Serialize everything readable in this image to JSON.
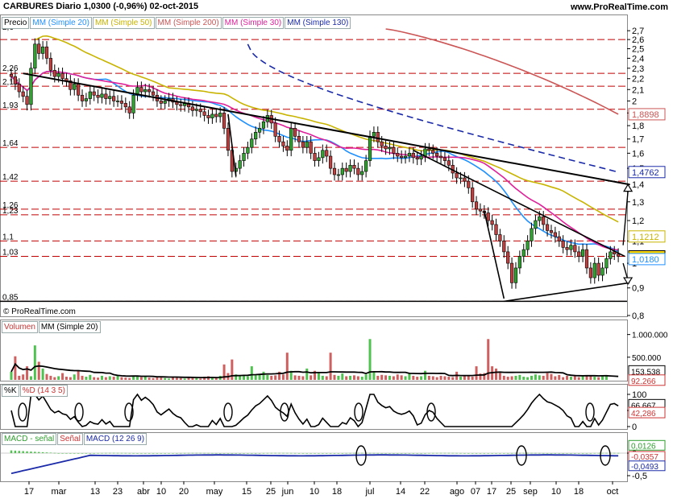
{
  "header": {
    "title": "CARBURES   Diario   1,0300 (-0,96%)   02-oct-2015",
    "site": "www.ProRealTime.com"
  },
  "price_panel": {
    "legend": [
      {
        "label": "Precio",
        "color": "#000000"
      },
      {
        "label": "MM (Simple 20)",
        "color": "#1e90ff"
      },
      {
        "label": "MM (Simple 50)",
        "color": "#c8b400"
      },
      {
        "label": "MM (Simple 200)",
        "color": "#cc5555"
      },
      {
        "label": "MM (Simple 30)",
        "color": "#e0209a"
      },
      {
        "label": "MM (Simple 130)",
        "color": "#1a2aa8"
      }
    ],
    "left_labels": [
      "2,26",
      "2,13",
      "1,93",
      "1,64",
      "1,42",
      "1,26",
      "1,23",
      "1,1",
      "1,03",
      "0,85"
    ],
    "top_left_label": "2,6",
    "watermark": "© ProRealTime.com",
    "y_ticks": [
      "2,7",
      "2,6",
      "2,5",
      "2,4",
      "2,3",
      "2,2",
      "2,1",
      "2",
      "1,9",
      "1,8",
      "1,7",
      "1,6",
      "1,5",
      "1,4",
      "1,3",
      "1,2",
      "1,1",
      "1",
      "0,9",
      "0,8"
    ],
    "badges": [
      {
        "text": "1,8898",
        "color": "#cc5555"
      },
      {
        "text": "1,4762",
        "color": "#1a2aa8"
      },
      {
        "text": "1,1212",
        "color": "#c8b400"
      },
      {
        "text": "1,0300",
        "color": "#000000"
      },
      {
        "text": "1,0180",
        "color": "#1e90ff"
      }
    ]
  },
  "volume_panel": {
    "legend": [
      "Volumen",
      "MM (Simple 20)"
    ],
    "y_ticks": [
      "1.000.000",
      "500.000"
    ],
    "badges": [
      "153.538",
      "92.266"
    ]
  },
  "stoch_panel": {
    "legend": [
      "%K",
      "%D (14 3 5)"
    ],
    "y_ticks": [
      "100",
      "50",
      "0"
    ],
    "badges": [
      "66,667",
      "42,286"
    ]
  },
  "macd_panel": {
    "legend": [
      "MACD - señal",
      "Señal",
      "MACD (12 26 9)"
    ],
    "y_ticks": [
      "0",
      "-0,5"
    ],
    "badges": [
      "0,0126",
      "-0,0357",
      "-0,0493"
    ]
  },
  "x_axis": {
    "labels": [
      "17",
      "mar",
      "13",
      "23",
      "abr",
      "10",
      "20",
      "may",
      "15",
      "25",
      "jun",
      "10",
      "18",
      "jul",
      "14",
      "22",
      "ago",
      "07",
      "17",
      "25",
      "sep",
      "10",
      "18",
      "oct"
    ]
  },
  "chart_data": {
    "type": "candlestick",
    "title": "CARBURES Diario 1,0300 (-0,96%) 02-oct-2015",
    "ylim": [
      0.8,
      2.72
    ],
    "y_scale": "log",
    "last_close": 1.03,
    "closes": [
      2.22,
      2.15,
      2.08,
      2.04,
      1.97,
      2.3,
      2.55,
      2.45,
      2.52,
      2.4,
      2.28,
      2.22,
      2.25,
      2.2,
      2.18,
      2.1,
      2.15,
      2.05,
      2.0,
      2.02,
      2.08,
      2.05,
      2.03,
      2.06,
      2.02,
      2.04,
      2.0,
      2.0,
      1.98,
      1.95,
      1.9,
      2.05,
      2.12,
      2.08,
      2.1,
      2.08,
      2.05,
      2.0,
      1.98,
      2.0,
      2.02,
      1.99,
      1.97,
      1.96,
      1.98,
      1.95,
      1.92,
      1.93,
      1.91,
      1.88,
      1.86,
      1.89,
      1.87,
      1.9,
      1.78,
      1.62,
      1.48,
      1.5,
      1.55,
      1.6,
      1.64,
      1.7,
      1.75,
      1.78,
      1.83,
      1.88,
      1.82,
      1.72,
      1.68,
      1.65,
      1.62,
      1.78,
      1.72,
      1.68,
      1.64,
      1.68,
      1.6,
      1.55,
      1.57,
      1.62,
      1.58,
      1.5,
      1.46,
      1.46,
      1.5,
      1.48,
      1.52,
      1.5,
      1.46,
      1.48,
      1.55,
      1.72,
      1.75,
      1.68,
      1.65,
      1.63,
      1.64,
      1.6,
      1.58,
      1.57,
      1.58,
      1.6,
      1.57,
      1.56,
      1.58,
      1.63,
      1.62,
      1.6,
      1.58,
      1.57,
      1.55,
      1.52,
      1.47,
      1.44,
      1.44,
      1.42,
      1.38,
      1.3,
      1.26,
      1.25,
      1.24,
      1.2,
      1.18,
      1.13,
      1.1,
      1.05,
      1.0,
      0.92,
      0.98,
      1.03,
      1.06,
      1.1,
      1.16,
      1.2,
      1.22,
      1.18,
      1.15,
      1.14,
      1.12,
      1.1,
      1.07,
      1.06,
      1.08,
      1.05,
      1.03,
      1.06,
      0.98,
      0.94,
      1.0,
      0.95,
      0.98,
      1.02,
      1.05,
      1.04,
      1.03
    ],
    "support_lines": [
      2.6,
      2.25,
      2.13,
      1.93,
      1.64,
      1.42,
      1.26,
      1.23,
      1.1,
      1.03,
      0.85
    ],
    "ma": {
      "mm20_end": 1.018,
      "mm30_end": 1.03,
      "mm50_end": 1.1212,
      "mm130_end": 1.4762,
      "mm200_end": 1.8898
    },
    "volume": [
      180000,
      520000,
      90000,
      120000,
      300000,
      80000,
      760000,
      400000,
      250000,
      130000,
      90000,
      60000,
      80000,
      150000,
      70000,
      60000,
      120000,
      200000,
      90000,
      70000,
      110000,
      60000,
      50000,
      90000,
      60000,
      80000,
      70000,
      100000,
      60000,
      50000,
      40000,
      90000,
      70000,
      60000,
      80000,
      50000,
      40000,
      60000,
      50000,
      40000,
      30000,
      60000,
      50000,
      40000,
      30000,
      50000,
      60000,
      40000,
      30000,
      70000,
      80000,
      60000,
      40000,
      90000,
      340000,
      150000,
      450000,
      120000,
      100000,
      90000,
      80000,
      300000,
      100000,
      120000,
      180000,
      110000,
      90000,
      100000,
      180000,
      120000,
      600000,
      200000,
      100000,
      90000,
      80000,
      250000,
      100000,
      200000,
      150000,
      90000,
      80000,
      600000,
      110000,
      90000,
      140000,
      80000,
      90000,
      100000,
      80000,
      70000,
      120000,
      900000,
      170000,
      90000,
      110000,
      100000,
      90000,
      80000,
      120000,
      100000,
      80000,
      140000,
      90000,
      70000,
      80000,
      200000,
      90000,
      80000,
      60000,
      90000,
      80000,
      70000,
      60000,
      180000,
      70000,
      90000,
      100000,
      70000,
      300000,
      140000,
      150000,
      900000,
      300000,
      250000,
      150000,
      90000,
      70000,
      80000,
      90000,
      110000,
      70000,
      60000,
      90000,
      120000,
      100000,
      90000,
      150000,
      130000,
      80000,
      110000,
      60000,
      90000,
      70000,
      110000,
      60000,
      80000,
      90000,
      100000,
      70000,
      60000,
      80000,
      90000
    ]
  }
}
